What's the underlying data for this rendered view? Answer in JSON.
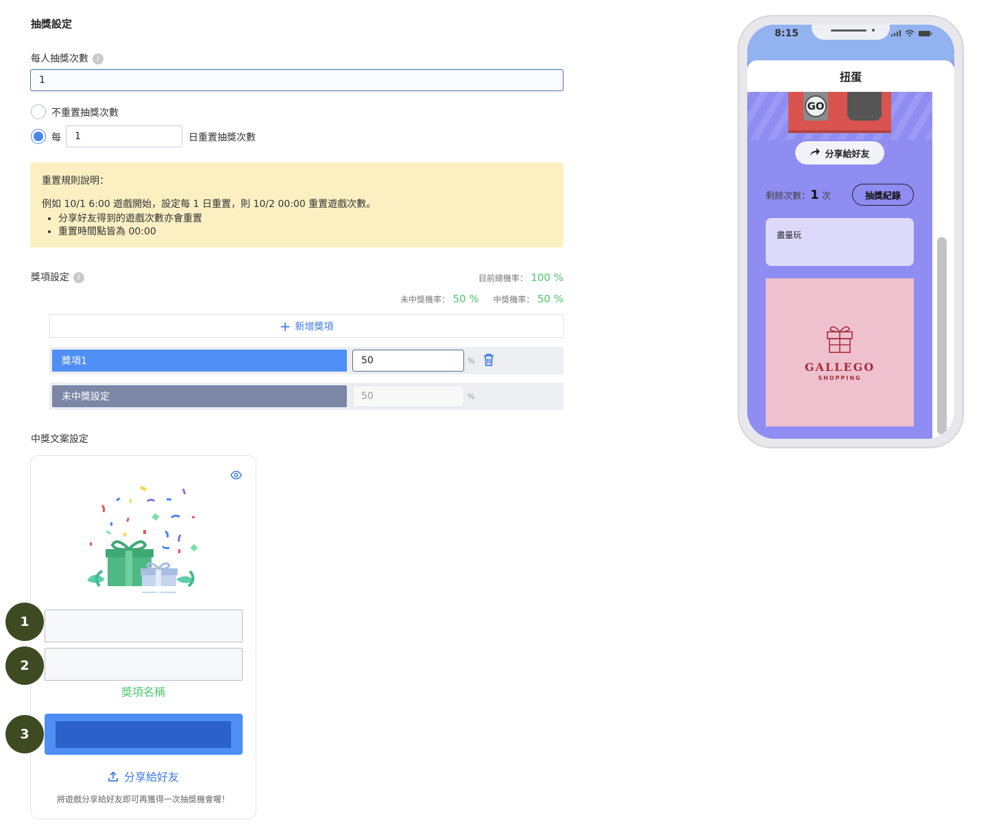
{
  "lottery": {
    "section_title": "抽獎設定",
    "per_person_label": "每人抽獎次數",
    "per_person_value": "1",
    "no_reset_label": "不重置抽獎次數",
    "every_label": "每",
    "reset_days_value": "1",
    "reset_suffix": "日重置抽獎次數",
    "selected_option": "reset_every_days"
  },
  "notice": {
    "title": "重置規則說明：",
    "example": "例如 10/1 6:00 遊戲開始，設定每 1 日重置，則 10/2 00:00 重置遊戲次數。",
    "bullets": [
      "分享好友得到的遊戲次數亦會重置",
      "重置時間點皆為 00:00"
    ]
  },
  "prizes": {
    "section_title": "獎項設定",
    "total_rate_label": "目前總機率：",
    "total_rate_value": "100 %",
    "lose_rate_label": "未中獎機率：",
    "lose_rate_value": "50 %",
    "win_rate_label": "中獎機率：",
    "win_rate_value": "50 %",
    "add_label": "新增獎項",
    "items": [
      {
        "name": "獎項1",
        "value": "50",
        "unit": "%",
        "color": "#4f8ef5"
      },
      {
        "name": "未中獎設定",
        "value": "50",
        "unit": "%",
        "color": "#7c87a6"
      }
    ]
  },
  "win_text": {
    "section_title": "中獎文案設定",
    "prize_name_hint": "獎項名稱",
    "share_label": "分享給好友",
    "share_note": "將遊戲分享給好友即可再獲得一次抽獎機會喔！",
    "badges": [
      "1",
      "2",
      "3"
    ],
    "primary_color": "#4f8ef5",
    "button_inner_color": "#2a62c9",
    "hint_color": "#4cc76a"
  },
  "phone": {
    "time": "8:15",
    "title": "扭蛋",
    "go_label": "GO",
    "share_label": "分享給好友",
    "remaining_label": "剩餘次數：",
    "remaining_value": "1",
    "remaining_unit": "次",
    "record_label": "抽獎紀錄",
    "desc_text": "盡量玩",
    "brand_name": "GALLEGO",
    "brand_sub": "SHOPPING",
    "bg_color": "#8f8cf2",
    "banner_color": "#efc1cf"
  }
}
